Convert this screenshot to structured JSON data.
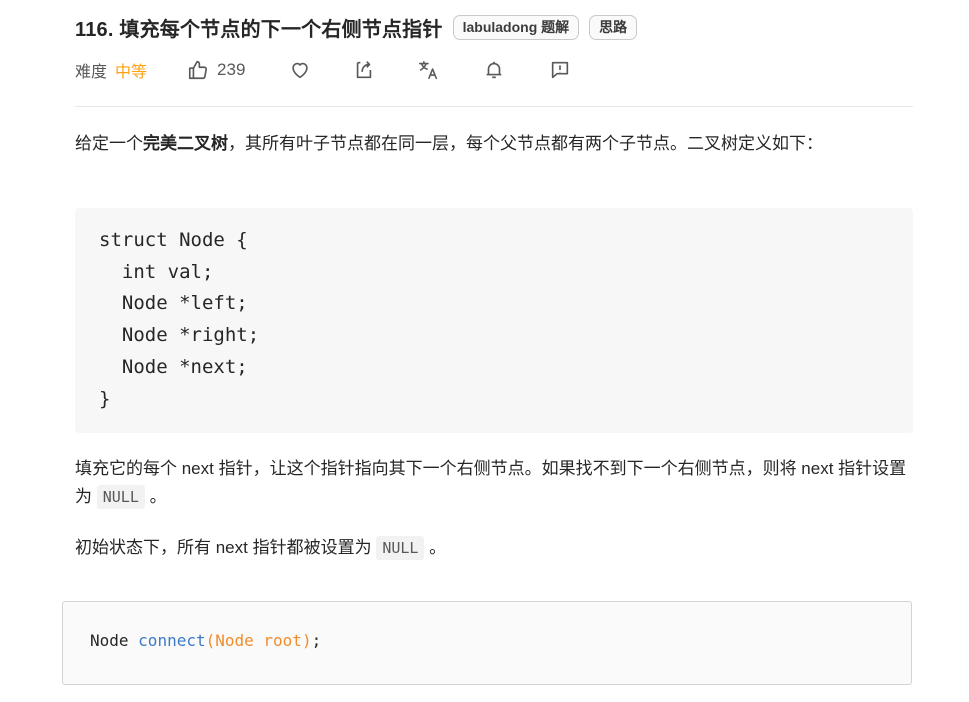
{
  "problem": {
    "title": "116. 填充每个节点的下一个右侧节点指针",
    "tags": [
      "labuladong 题解",
      "思路"
    ]
  },
  "meta": {
    "difficulty_label": "难度",
    "difficulty_value": "中等",
    "likes": "239",
    "icons": [
      "thumbs-up-icon",
      "heart-icon",
      "share-icon",
      "translate-icon",
      "bell-icon",
      "feedback-icon"
    ]
  },
  "description": {
    "p1_pre": "给定一个",
    "p1_bold": "完美二叉树",
    "p1_post": "，其所有叶子节点都在同一层，每个父节点都有两个子节点。二叉树定义如下：",
    "code": "struct Node {\n  int val;\n  Node *left;\n  Node *right;\n  Node *next;\n}",
    "p2_pre": "填充它的每个 next 指针，让这个指针指向其下一个右侧节点。如果找不到下一个右侧节点，则将 next 指针设置为 ",
    "p2_code": "NULL",
    "p2_post": "。",
    "p3_pre": "初始状态下，所有 next 指针都被设置为 ",
    "p3_code": "NULL",
    "p3_post": "。"
  },
  "editor": {
    "type": "Node",
    "fn": "connect",
    "params": "(Node root)",
    "end": ";"
  },
  "colors": {
    "difficulty": "#ffa116",
    "function": "#3d7bc7",
    "param": "#f08d2c"
  }
}
